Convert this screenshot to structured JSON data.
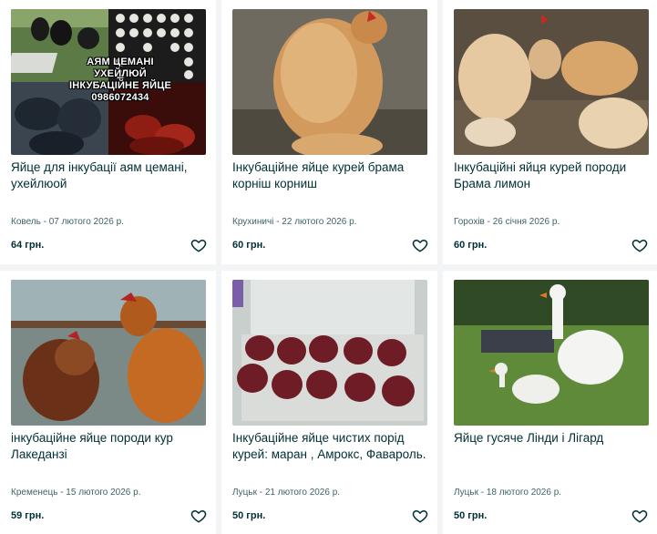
{
  "listings": [
    {
      "title": "Яйце для інкубації аям цемані, ухейлюой",
      "location_date": "Ковель - 07 лютого 2026 р.",
      "price": "64 грн.",
      "photo_text": [
        "АЯМ ЦЕМАНІ",
        "УХЕЙЛЮЙ",
        "ІНКУБАЦІЙНЕ ЯЙЦЕ",
        "0986072434"
      ]
    },
    {
      "title": "Інкубаційне яйце курей брама корніш корниш",
      "location_date": "Крухиничі - 22 лютого 2026 р.",
      "price": "60 грн."
    },
    {
      "title": "Інкубаційні яйця курей породи Брама лимон",
      "location_date": "Горохів - 26 січня 2026 р.",
      "price": "60 грн."
    },
    {
      "title": "інкубаційне яйце породи кур Лакеданзі",
      "location_date": "Кременець - 15 лютого 2026 р.",
      "price": "59 грн."
    },
    {
      "title": "Інкубаційне яйце чистих порід курей: маран , Амрокс, Фавароль.",
      "location_date": "Луцьк - 21 лютого 2026 р.",
      "price": "50 грн."
    },
    {
      "title": "Яйце гусяче Лінди і Лігард",
      "location_date": "Луцьк - 18 лютого 2026 р.",
      "price": "50 грн."
    }
  ],
  "icons": {
    "favorite": "heart-outline-icon"
  }
}
